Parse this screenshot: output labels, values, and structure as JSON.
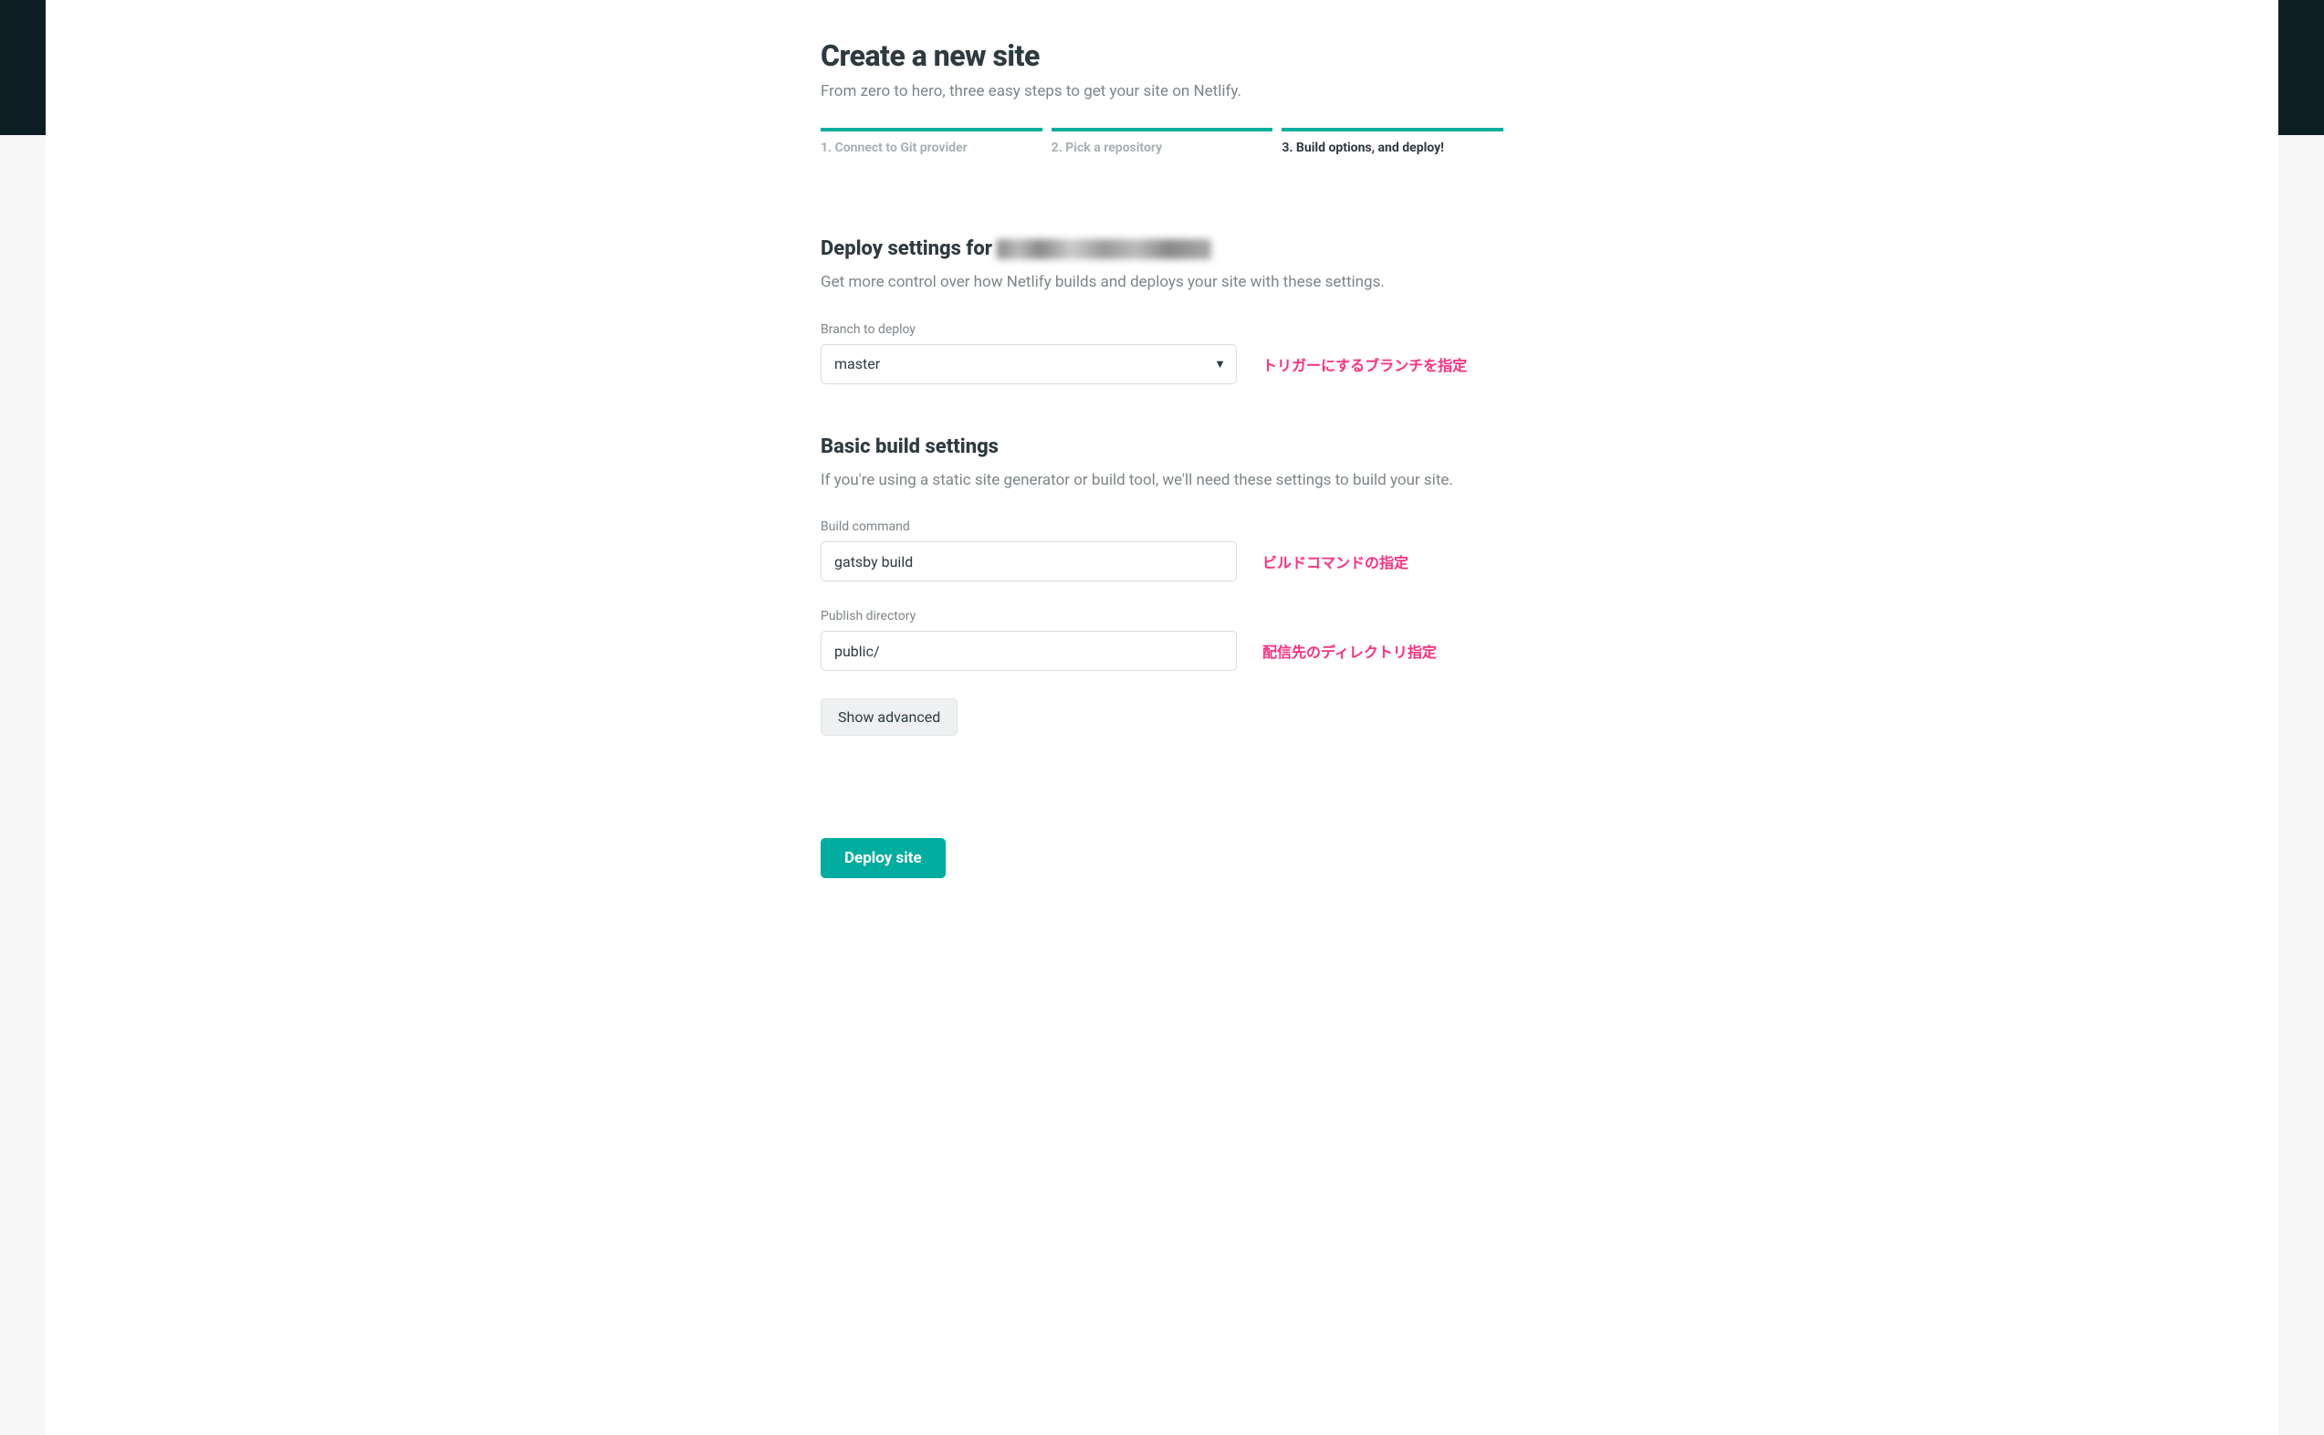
{
  "header": {
    "title": "Create a new site",
    "subtitle": "From zero to hero, three easy steps to get your site on Netlify."
  },
  "stepper": {
    "step1": "1. Connect to Git provider",
    "step2": "2. Pick a repository",
    "step3": "3. Build options, and deploy!"
  },
  "deploy_settings": {
    "title_prefix": "Deploy settings for",
    "description": "Get more control over how Netlify builds and deploys your site with these settings.",
    "branch_label": "Branch to deploy",
    "branch_value": "master"
  },
  "build_settings": {
    "title": "Basic build settings",
    "description": "If you're using a static site generator or build tool, we'll need these settings to build your site.",
    "build_command_label": "Build command",
    "build_command_value": "gatsby build",
    "publish_dir_label": "Publish directory",
    "publish_dir_value": "public/"
  },
  "annotations": {
    "branch": "トリガーにするブランチを指定",
    "build_command": "ビルドコマンドの指定",
    "publish_dir": "配信先のディレクトリ指定"
  },
  "buttons": {
    "show_advanced": "Show advanced",
    "deploy": "Deploy site"
  }
}
